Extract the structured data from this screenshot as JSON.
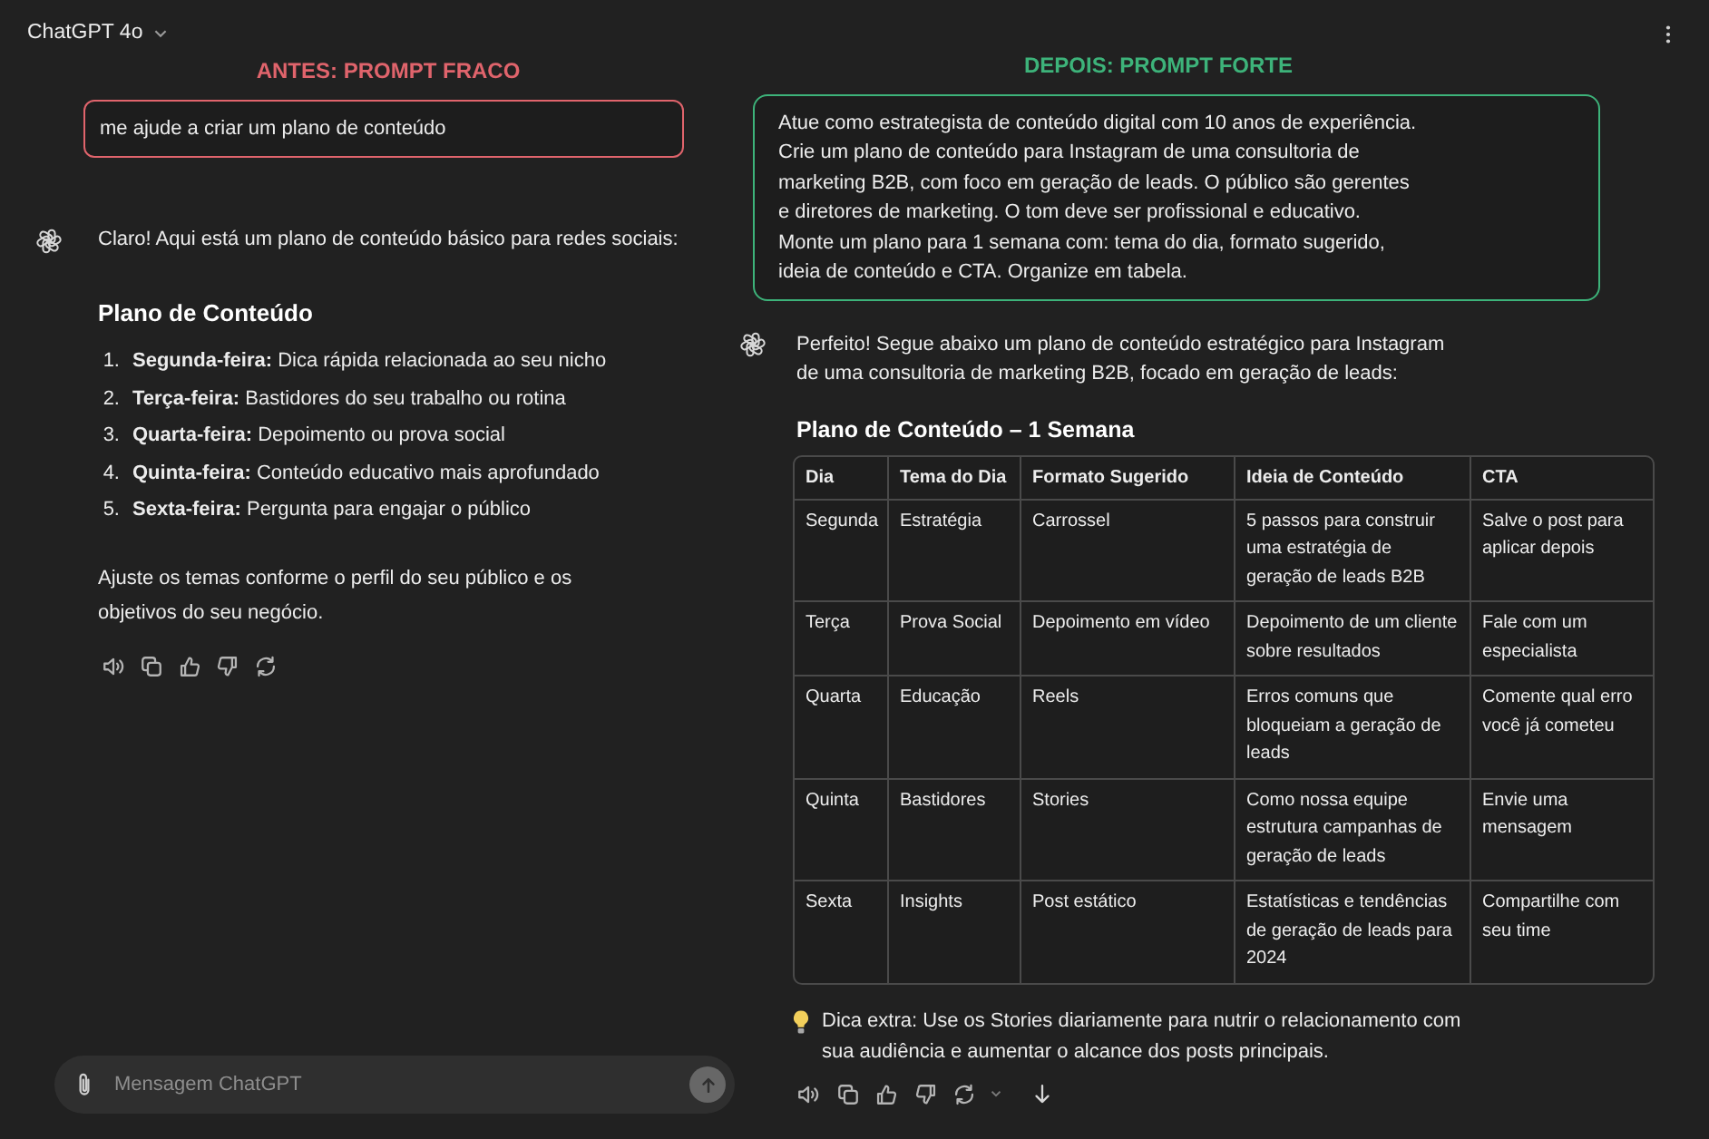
{
  "header": {
    "model": "ChatGPT 4o"
  },
  "panels": [
    {
      "heading": "ANTES: PROMPT FRACO",
      "color": "#e0646c",
      "prompt": "me ajude a criar um plano de conteúdo",
      "response": [
        {
          "kind": "paragraph",
          "text": "Claro! Aqui está um plano de conteúdo básico para redes sociais:"
        },
        {
          "kind": "heading",
          "text": "Plano de Conteúdo"
        },
        {
          "kind": "list",
          "items": [
            {
              "number": "1.",
              "text": "**Segunda-feira:** Dica rápida relacionada ao seu nicho"
            },
            {
              "number": "2.",
              "text": "**Terça-feira:** Bastidores do seu trabalho ou rotina"
            },
            {
              "number": "3.",
              "text": "**Quarta-feira:** Depoimento ou prova social"
            },
            {
              "number": "4.",
              "text": "**Quinta-feira:** Conteúdo educativo mais aprofundado"
            },
            {
              "number": "5.",
              "text": "**Sexta-feira:** Pergunta para engajar o público"
            }
          ]
        },
        {
          "kind": "paragraph",
          "text": "Ajuste os temas conforme o perfil do seu público e os\nobjetivos do seu negócio."
        }
      ]
    },
    {
      "heading": "DEPOIS: PROMPT FORTE",
      "color": "#3db37a",
      "prompt": "Atue como estrategista de conteúdo digital com 10 anos de experiência.\nCrie um plano de conteúdo para Instagram de uma consultoria de\nmarketing B2B, com foco em geração de leads. O público são gerentes\ne diretores de marketing. O tom deve ser profissional e educativo.\nMonte um plano para 1 semana com: tema do dia, formato sugerido,\nideia de conteúdo e CTA. Organize em tabela.",
      "response": [
        {
          "kind": "paragraph",
          "text": "Perfeito! Segue abaixo um plano de conteúdo estratégico para Instagram\nde uma consultoria de marketing B2B, focado em geração de leads:"
        },
        {
          "kind": "heading",
          "text": "Plano de Conteúdo – 1 Semana"
        },
        {
          "kind": "table",
          "columns": [
            "Dia",
            "Tema do Dia",
            "Formato Sugerido",
            "Ideia de Conteúdo",
            "CTA"
          ],
          "rows": [
            [
              "Segunda",
              "Estratégia",
              "Carrossel",
              "5 passos para construir uma estratégia de geração de leads B2B",
              "Salve o post para aplicar depois"
            ],
            [
              "Terça",
              "Prova Social",
              "Depoimento em vídeo",
              "Depoimento de um cliente sobre resultados",
              "Fale com um especialista"
            ],
            [
              "Quarta",
              "Educação",
              "Reels",
              "Erros comuns que bloqueiam a geração de leads",
              "Comente qual erro você já cometeu"
            ],
            [
              "Quinta",
              "Bastidores",
              "Stories",
              "Como nossa equipe estrutura campanhas de geração de leads",
              "Envie uma mensagem"
            ],
            [
              "Sexta",
              "Insights",
              "Post estático",
              "Estatísticas e tendências de geração de leads para 2024",
              "Compartilhe com seu time"
            ]
          ]
        },
        {
          "kind": "tip",
          "text": "Dica extra: Use os Stories diariamente para nutrir o relacionamento com\nsua audiência e aumentar o alcance dos posts principais."
        }
      ],
      "regenerate_menu": true,
      "scroll_down": true
    }
  ],
  "composer": {
    "placeholder": "Mensagem ChatGPT"
  }
}
